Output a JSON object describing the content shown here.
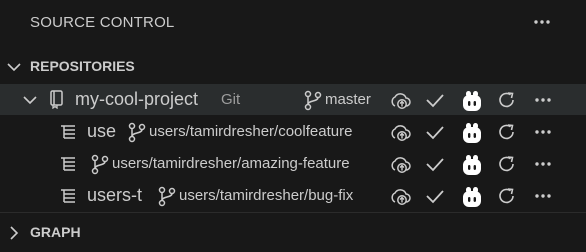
{
  "panel": {
    "title": "SOURCE CONTROL"
  },
  "sections": {
    "repositories": "REPOSITORIES",
    "graph": "GRAPH"
  },
  "repository": {
    "name": "my-cool-project",
    "kind": "Git",
    "branch": "master"
  },
  "worktrees": [
    {
      "name": "use",
      "branch": "users/tamirdresher/coolfeature"
    },
    {
      "name": "",
      "branch": "users/tamirdresher/amazing-feature"
    },
    {
      "name": "users-t",
      "branch": "users/tamirdresher/bug-fix"
    }
  ],
  "icons": {
    "more": "more-icon",
    "chevron_down": "chevron-down-icon",
    "chevron_right": "chevron-right-icon",
    "repo": "repo-icon",
    "worktree": "list-tree-icon",
    "branch": "git-branch-icon",
    "publish": "cloud-upload-icon",
    "commit": "check-icon",
    "copilot": "copilot-icon",
    "refresh": "refresh-icon"
  },
  "colors": {
    "background": "#181818",
    "selected_row": "#2a2d2e",
    "foreground": "#cccccc",
    "description": "#9d9d9d",
    "copilot_icon": "#ffffff"
  }
}
